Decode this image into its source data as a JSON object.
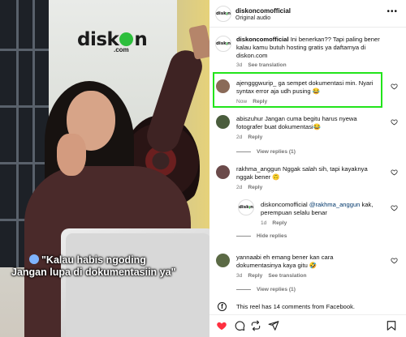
{
  "media": {
    "logo_left": "disk",
    "logo_right": "n",
    "logo_sub": ".com",
    "caption_line1": "\"Kalau habis ngoding",
    "caption_line2": "Jangan lupa di dokumentasiin ya\""
  },
  "header": {
    "avatar_text_left": "disk",
    "avatar_text_right": "n",
    "username": "diskoncomofficial",
    "audio": "Original audio",
    "more_icon": "more-horizontal-icon"
  },
  "caption_post": {
    "username": "diskoncomofficial",
    "text": "Ini benerkan?? Tapi paling bener kalau kamu butuh hosting gratis ya daftarnya di diskon.com",
    "time": "3d",
    "action": "See translation"
  },
  "comments": [
    {
      "username": "ajengggwurip_",
      "text": "ga sempet dokumentasi min. Nyari syntax error aja udh pusing 😂",
      "time": "Now",
      "reply": "Reply"
    },
    {
      "username": "abiszuhur",
      "text": "Jangan cuma begitu harus nyewa fotografer buat dokumentasi😂",
      "time": "2d",
      "reply": "Reply",
      "view_replies": "View replies (1)"
    },
    {
      "username": "rakhma_anggun",
      "text": "Nggak salah sih, tapi kayaknya nggak bener 🙃",
      "time": "2d",
      "reply": "Reply"
    },
    {
      "username": "yannaabi",
      "text": "eh emang bener kan cara dokumentasinya kaya gitu 🤣",
      "time": "3d",
      "reply": "Reply",
      "translation": "See translation",
      "view_replies": "View replies (1)"
    }
  ],
  "reply": {
    "avatar_text_left": "disk",
    "avatar_text_right": "n",
    "username": "diskoncomofficial",
    "mention": "@rakhma_anggun",
    "text": "kak, perempuan selalu benar",
    "time": "1d",
    "reply": "Reply",
    "hide_replies": "Hide replies"
  },
  "facebook_note": "This reel has 14 comments from Facebook.",
  "actions": {
    "like": "heart-filled-icon",
    "comment": "comment-icon",
    "share": "repost-icon",
    "send": "send-icon",
    "save": "bookmark-icon"
  },
  "colors": {
    "brand_green": "#2dbf3c",
    "highlight": "#22e41b",
    "like_red": "#ff3040",
    "meta_grey": "#737373"
  }
}
